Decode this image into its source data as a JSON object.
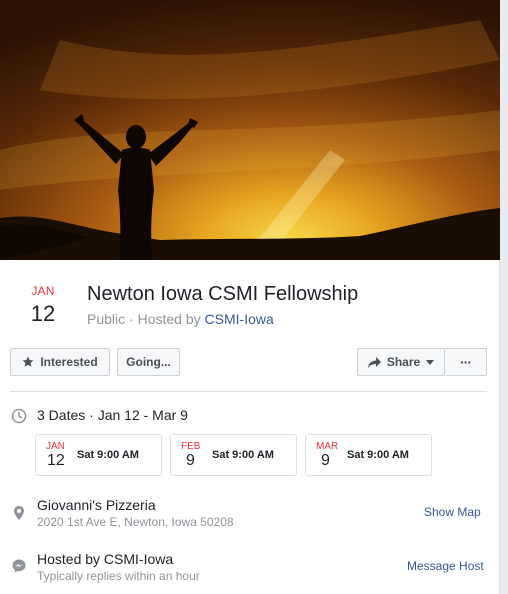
{
  "event": {
    "month": "JAN",
    "day": "12",
    "title": "Newton Iowa CSMI Fellowship",
    "privacy": "Public",
    "hosted_prefix": "Hosted by",
    "host": "CSMI-Iowa"
  },
  "actions": {
    "interested_label": "Interested",
    "going_label": "Going...",
    "share_label": "Share",
    "more_label": "···"
  },
  "dates": {
    "summary": "3 Dates · Jan 12 - Mar 9",
    "items": [
      {
        "month": "JAN",
        "day": "12",
        "time": "Sat 9:00 AM"
      },
      {
        "month": "FEB",
        "day": "9",
        "time": "Sat 9:00 AM"
      },
      {
        "month": "MAR",
        "day": "9",
        "time": "Sat 9:00 AM"
      }
    ]
  },
  "location": {
    "name": "Giovanni's Pizzeria",
    "address": "2020 1st Ave E, Newton, Iowa 50208",
    "show_map_label": "Show Map"
  },
  "host": {
    "name": "Hosted by CSMI-Iowa",
    "response": "Typically replies within an hour",
    "message_label": "Message Host"
  },
  "icons": {
    "clock": "clock-icon",
    "pin": "map-pin-icon",
    "messenger": "messenger-icon",
    "star": "star-icon",
    "share": "share-arrow-icon",
    "caret": "caret-down-icon"
  },
  "colors": {
    "accent_red": "#e9373e",
    "link_blue": "#385898",
    "muted_gray": "#90949c"
  }
}
